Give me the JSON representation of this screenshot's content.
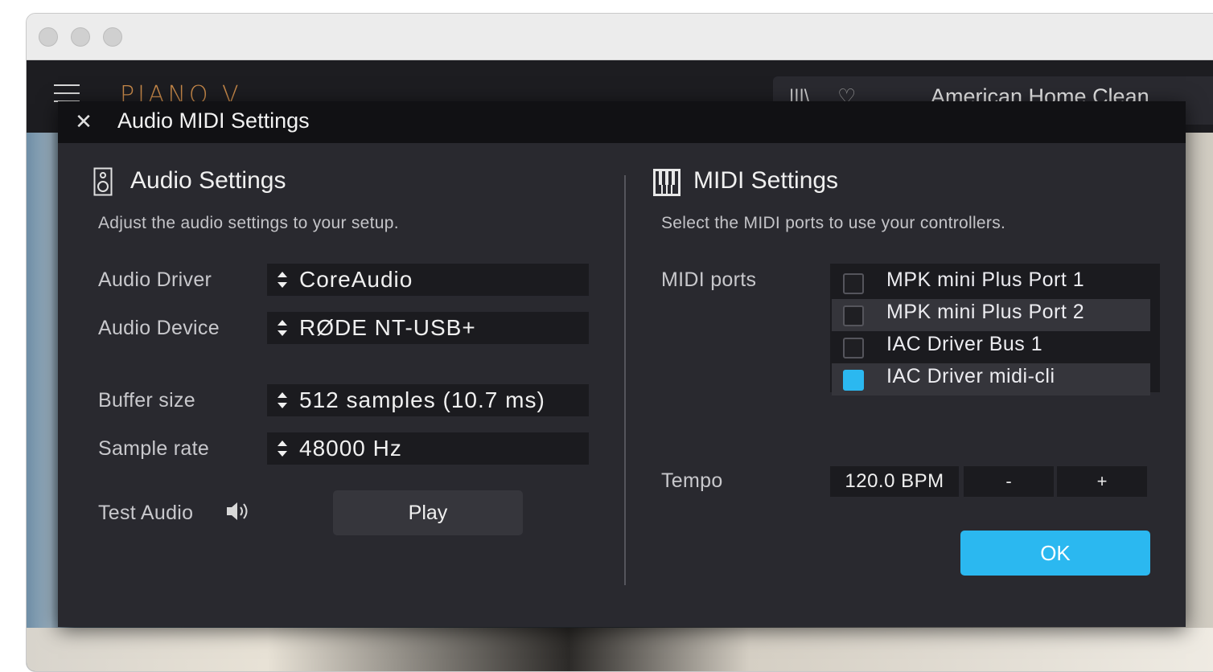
{
  "app": {
    "logo": "PIANO V",
    "preset_name": "American Home Clean"
  },
  "dialog": {
    "title": "Audio MIDI Settings",
    "close_glyph": "✕"
  },
  "audio": {
    "title": "Audio Settings",
    "description": "Adjust the audio settings to your setup.",
    "driver_label": "Audio Driver",
    "driver_value": "CoreAudio",
    "device_label": "Audio Device",
    "device_value": "RØDE NT-USB+",
    "buffer_label": "Buffer size",
    "buffer_value": "512 samples (10.7 ms)",
    "rate_label": "Sample rate",
    "rate_value": "48000 Hz",
    "test_label": "Test Audio",
    "play_label": "Play"
  },
  "midi": {
    "title": "MIDI Settings",
    "description": "Select the MIDI ports to use your controllers.",
    "ports_label": "MIDI ports",
    "ports": [
      {
        "label": "MPK mini Plus Port 1",
        "checked": false
      },
      {
        "label": "MPK mini Plus Port 2",
        "checked": false
      },
      {
        "label": "IAC Driver Bus 1",
        "checked": false
      },
      {
        "label": "IAC Driver midi-cli",
        "checked": true
      }
    ],
    "tempo_label": "Tempo",
    "tempo_value": "120.0 BPM",
    "tempo_minus": "-",
    "tempo_plus": "+",
    "ok_label": "OK"
  },
  "colors": {
    "accent": "#2bb8f0",
    "dialog_bg": "#29292f",
    "header_bg": "#111114"
  }
}
